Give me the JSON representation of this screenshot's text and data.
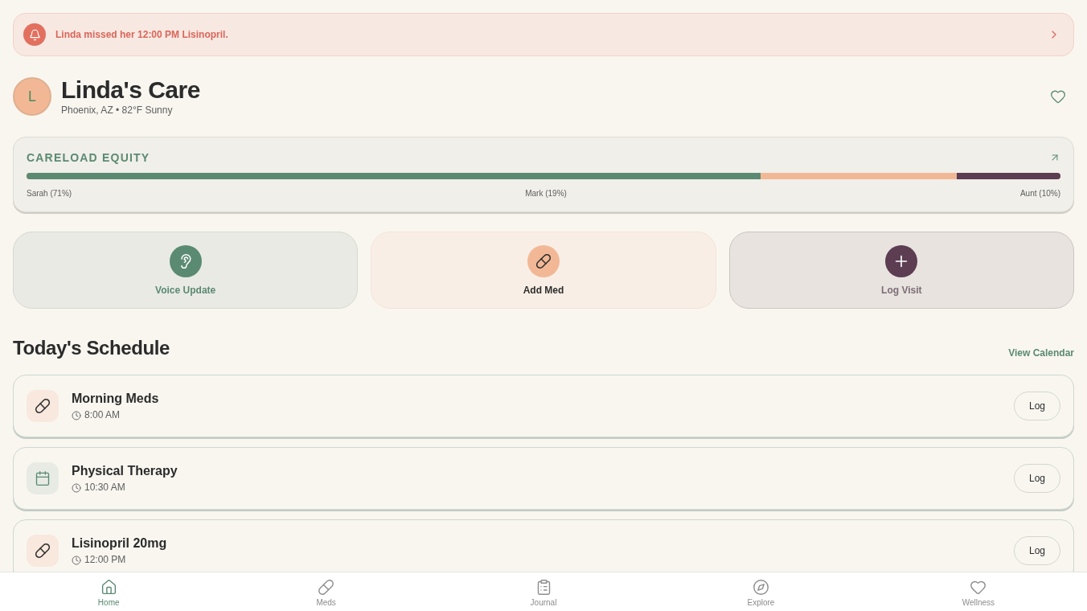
{
  "alert": {
    "message": "Linda missed her 12:00 PM Lisinopril."
  },
  "header": {
    "avatar_initial": "L",
    "title": "Linda's Care",
    "subtitle": "Phoenix, AZ • 82°F Sunny"
  },
  "careload": {
    "title": "CARELOAD EQUITY",
    "segments": [
      {
        "kind": "start",
        "label": "Sarah (71%)",
        "level": 0.71,
        "color": "#5b8a72"
      },
      {
        "kind": "rest",
        "label": "Mark (19%)",
        "color": "#f2b896"
      },
      {
        "kind": "end",
        "label": "Aunt (10%)",
        "level": 0.1,
        "color": "#5c3d52"
      }
    ]
  },
  "actions": [
    {
      "kind": "voice",
      "label": "Voice Update"
    },
    {
      "kind": "med",
      "label": "Add Med"
    },
    {
      "kind": "visit",
      "label": "Log Visit"
    }
  ],
  "schedule": {
    "title": "Today's Schedule",
    "link": "View Calendar",
    "items": [
      {
        "kind": "med",
        "title": "Morning Meds",
        "time": "8:00 AM",
        "button": "Log"
      },
      {
        "kind": "appointment",
        "title": "Physical Therapy",
        "time": "10:30 AM",
        "button": "Log"
      },
      {
        "kind": "med",
        "title": "Lisinopril 20mg",
        "time": "12:00 PM",
        "button": "Log"
      }
    ]
  },
  "nav": [
    {
      "kind": "home",
      "label": "Home",
      "selected": true
    },
    {
      "kind": "meds",
      "label": "Meds",
      "selected": false
    },
    {
      "kind": "journal",
      "label": "Journal",
      "selected": false
    },
    {
      "kind": "explore",
      "label": "Explore",
      "selected": false
    },
    {
      "kind": "wellness",
      "label": "Wellness",
      "selected": false
    }
  ]
}
